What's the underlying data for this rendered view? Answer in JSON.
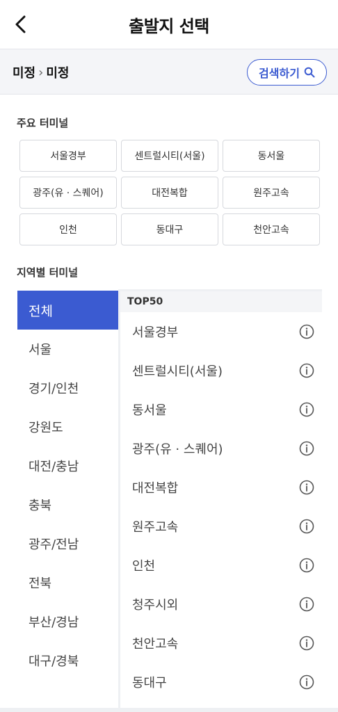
{
  "header": {
    "title": "출발지 선택",
    "back_icon": "chevron-left-icon"
  },
  "route": {
    "from": "미정",
    "separator": "›",
    "to": "미정",
    "search_label": "검색하기",
    "search_icon": "search-icon"
  },
  "major": {
    "title": "주요 터미널",
    "items": [
      "서울경부",
      "센트럴시티(서울)",
      "동서울",
      "광주(유 · 스퀘어)",
      "대전복합",
      "원주고속",
      "인천",
      "동대구",
      "천안고속"
    ]
  },
  "regional": {
    "title": "지역별 터미널",
    "regions": [
      "전체",
      "서울",
      "경기/인천",
      "강원도",
      "대전/충남",
      "충북",
      "광주/전남",
      "전북",
      "부산/경남",
      "대구/경북"
    ],
    "selected": "전체",
    "list_label": "TOP50",
    "terminals": [
      "서울경부",
      "센트럴시티(서울)",
      "동서울",
      "광주(유 · 스퀘어)",
      "대전복합",
      "원주고속",
      "인천",
      "청주시외",
      "천안고속",
      "동대구"
    ],
    "info_icon": "info-icon"
  },
  "colors": {
    "accent": "#3b5bd1",
    "route_bg": "#f4f5f8"
  }
}
